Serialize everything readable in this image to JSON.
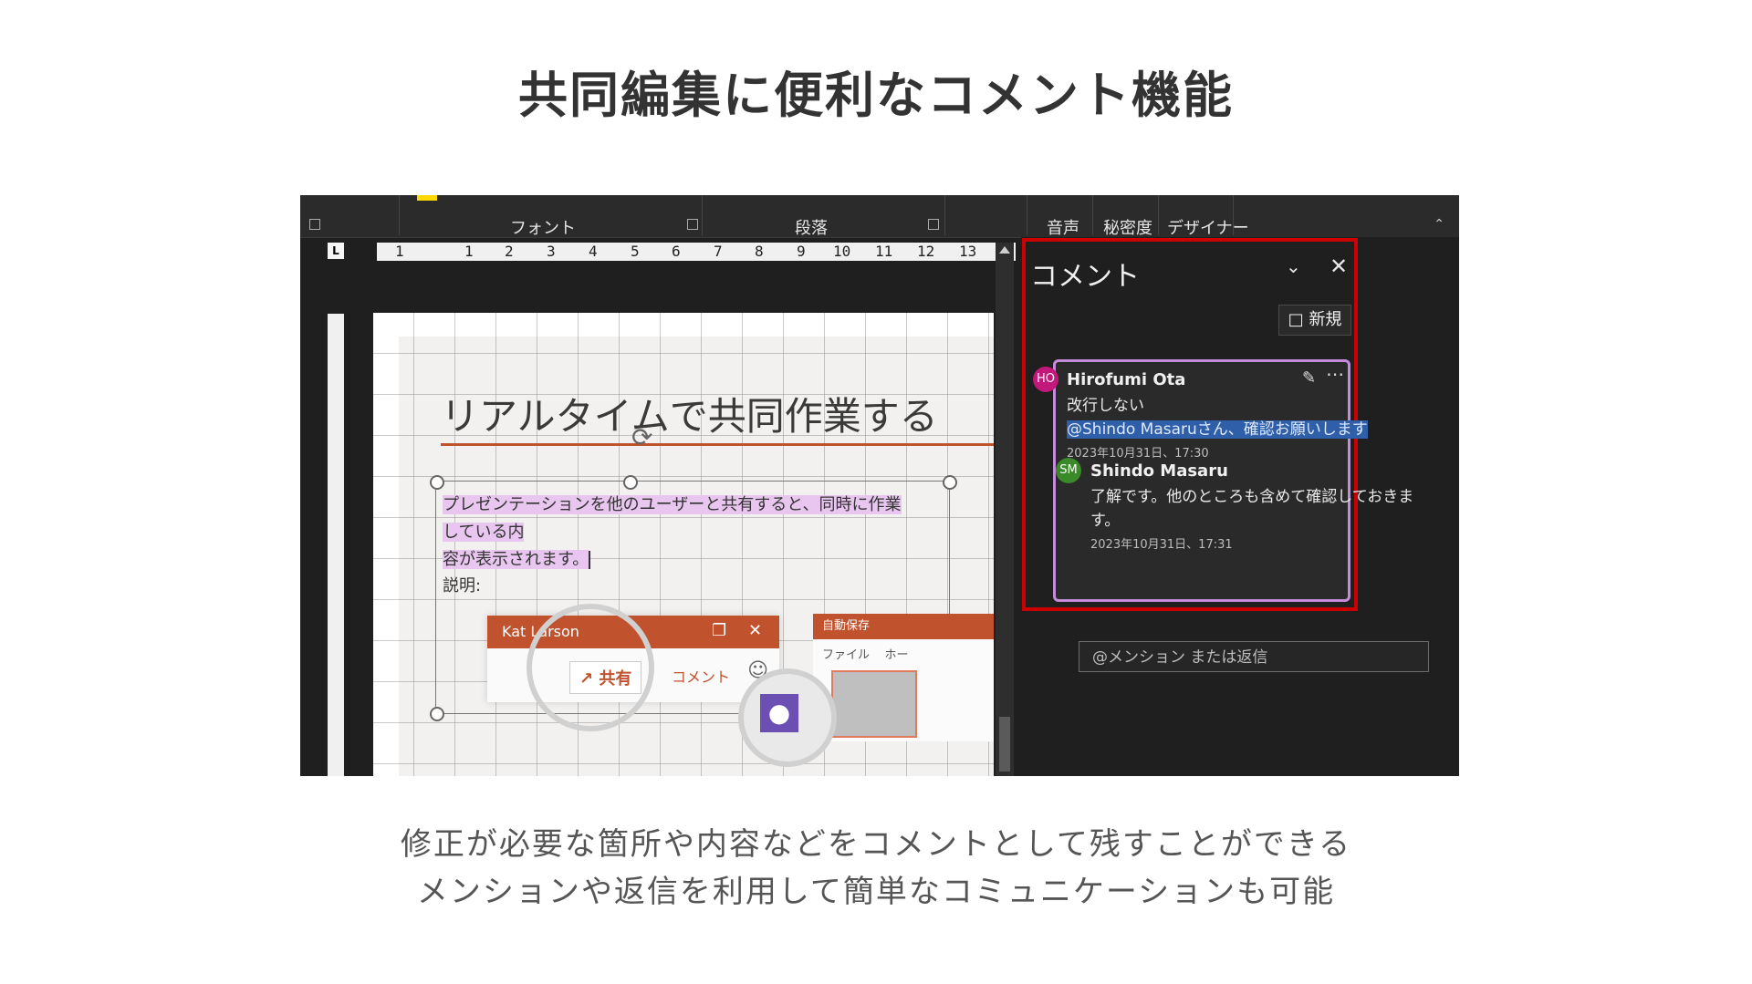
{
  "headline": "共同編集に便利なコメント機能",
  "captions": [
    "修正が必要な箇所や内容などをコメントとして残すことができる",
    "メンションや返信を利用して簡単なコミュニケーションも可能"
  ],
  "ribbon": {
    "groups": [
      "フォント",
      "段落",
      "音声",
      "秘密度",
      "デザイナー"
    ]
  },
  "ruler": {
    "corner": "L",
    "numbers": [
      "1",
      "1",
      "2",
      "3",
      "4",
      "5",
      "6",
      "7",
      "8",
      "9",
      "10",
      "11",
      "12",
      "13"
    ]
  },
  "slide": {
    "title": "リアルタイムで共同作業する",
    "body_line1": "プレゼンテーションを他のユーザーと共有すると、同時に作業している内",
    "body_line2": "容が表示されます。",
    "desc_label": "説明:",
    "mini_user": "Kat Larson",
    "share_label": "共有",
    "comment_label": "コメント",
    "autosave_label": "自動保存",
    "file_menu": "ファイル",
    "home_menu": "ホー"
  },
  "comments_pane": {
    "title": "コメント",
    "new_label": "新規",
    "thread": [
      {
        "initials": "HO",
        "author": "Hirofumi Ota",
        "text_line1": "改行しない",
        "mention": "@Shindo Masaruさん、確認お願いします",
        "time": "2023年10月31日、17:30",
        "avatar_color": "#c2187a"
      },
      {
        "initials": "SM",
        "author": "Shindo Masaru",
        "text_line1": "了解です。他のところも含めて確認しておきま",
        "text_line2": "す。",
        "time": "2023年10月31日、17:31",
        "avatar_color": "#3a8a2a"
      }
    ],
    "reply_placeholder": "@メンション または返信"
  },
  "colors": {
    "highlight_frame": "#cc0000",
    "thread_border": "#c58bdb",
    "accent": "#c0522d"
  }
}
